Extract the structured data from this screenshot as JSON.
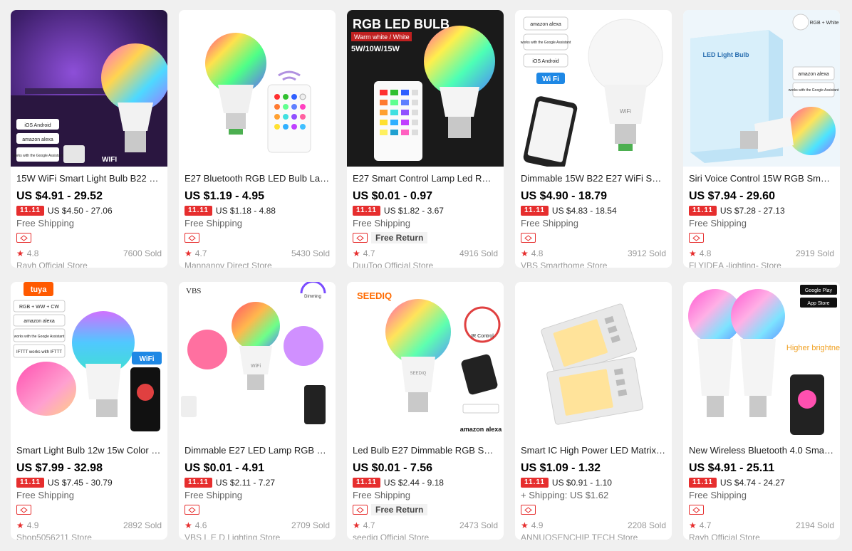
{
  "promo_badge": "11.11",
  "products": [
    {
      "title": "15W WiFi Smart Light Bulb B22 E2...",
      "price": "US $4.91 - 29.52",
      "promo_price": "US $4.50 - 27.06",
      "shipping": "Free Shipping",
      "free_return": "",
      "rating": "4.8",
      "sold": "7600 Sold",
      "store": "Rayh Official Store"
    },
    {
      "title": "E27 Bluetooth RGB LED Bulb Lamp...",
      "price": "US $1.19 - 4.95",
      "promo_price": "US $1.18 - 4.88",
      "shipping": "Free Shipping",
      "free_return": "",
      "rating": "4.7",
      "sold": "5430 Sold",
      "store": "Mannanov Direct Store"
    },
    {
      "title": "E27 Smart Control Lamp Led RGB ...",
      "price": "US $0.01 - 0.97",
      "promo_price": "US $1.82 - 3.67",
      "shipping": "Free Shipping",
      "free_return": "Free Return",
      "rating": "4.7",
      "sold": "4916 Sold",
      "store": "DuuToo Official Store"
    },
    {
      "title": "Dimmable 15W B22 E27 WiFi Smar...",
      "price": "US $4.90 - 18.79",
      "promo_price": "US $4.83 - 18.54",
      "shipping": "Free Shipping",
      "free_return": "",
      "rating": "4.8",
      "sold": "3912 Sold",
      "store": "VBS Smarthome Store"
    },
    {
      "title": "Siri Voice Control 15W RGB Smart ...",
      "price": "US $7.94 - 29.60",
      "promo_price": "US $7.28 - 27.13",
      "shipping": "Free Shipping",
      "free_return": "",
      "rating": "4.8",
      "sold": "2919 Sold",
      "store": "FLYIDEA -lighting- Store"
    },
    {
      "title": "Smart Light Bulb 12w 15w Color C...",
      "price": "US $7.99 - 32.98",
      "promo_price": "US $7.45 - 30.79",
      "shipping": "Free Shipping",
      "free_return": "",
      "rating": "4.9",
      "sold": "2892 Sold",
      "store": "Shop5056211 Store"
    },
    {
      "title": "Dimmable E27 LED Lamp RGB 15...",
      "price": "US $0.01 - 4.91",
      "promo_price": "US $2.11 - 7.27",
      "shipping": "Free Shipping",
      "free_return": "",
      "rating": "4.6",
      "sold": "2709 Sold",
      "store": "VBS L E D Lighting Store"
    },
    {
      "title": "Led Bulb E27 Dimmable RGB Smar...",
      "price": "US $0.01 - 7.56",
      "promo_price": "US $2.44 - 9.18",
      "shipping": "Free Shipping",
      "free_return": "Free Return",
      "rating": "4.7",
      "sold": "2473 Sold",
      "store": "seediq Official Store"
    },
    {
      "title": "Smart IC High Power LED Matrix F...",
      "price": "US $1.09 - 1.32",
      "promo_price": "US $0.91 - 1.10",
      "shipping": "+ Shipping: US $1.62",
      "free_return": "",
      "rating": "4.9",
      "sold": "2208 Sold",
      "store": "ANNUOSENCHIP TECH Store"
    },
    {
      "title": "New Wireless Bluetooth 4.0 Smart ...",
      "price": "US $4.91 - 25.11",
      "promo_price": "US $4.74 - 24.27",
      "shipping": "Free Shipping",
      "free_return": "",
      "rating": "4.7",
      "sold": "2194 Sold",
      "store": "Rayh Official Store"
    }
  ],
  "image_text": {
    "p1": {
      "ios": "iOS Android",
      "alexa": "amazon alexa",
      "google": "works with the Google Assistant",
      "wifi": "WIFI"
    },
    "p3": {
      "headline": "RGB LED BULB",
      "sub": "Warm white / White",
      "watt": "5W/10W/15W"
    },
    "p4": {
      "alexa": "amazon alexa",
      "google": "works with the Google Assistant",
      "ios": "iOS Android",
      "wifi": "Wi Fi",
      "bulb_label": "WiFi"
    },
    "p5": {
      "rgbw": "RGB + White",
      "box": "LED Light Bulb",
      "alexa": "amazon alexa",
      "google": "works with the Google Assistant"
    },
    "p6": {
      "brand": "tuya",
      "modes": "RGB + WW + CW",
      "alexa": "amazon alexa",
      "google": "works with the Google Assistant",
      "ifttt": "IFTTT works with IFTTT",
      "wifi": "WiFi"
    },
    "p7": {
      "brand": "VBS",
      "dimming": "Dimming",
      "bulb_label": "WiFi"
    },
    "p8": {
      "brand": "SEEDIQ",
      "ir": "IR Control",
      "bulb_label": "SEEDIQ",
      "alexa": "amazon alexa"
    },
    "p10": {
      "gp": "Google Play",
      "as": "App Store",
      "higher": "Higher brightness"
    }
  },
  "icon_names": [
    "star-icon",
    "choice-icon"
  ],
  "colors": {
    "accent": "#e62e2e",
    "muted": "#999999",
    "card_bg": "#ffffff",
    "page_bg": "#f0f0f0"
  }
}
